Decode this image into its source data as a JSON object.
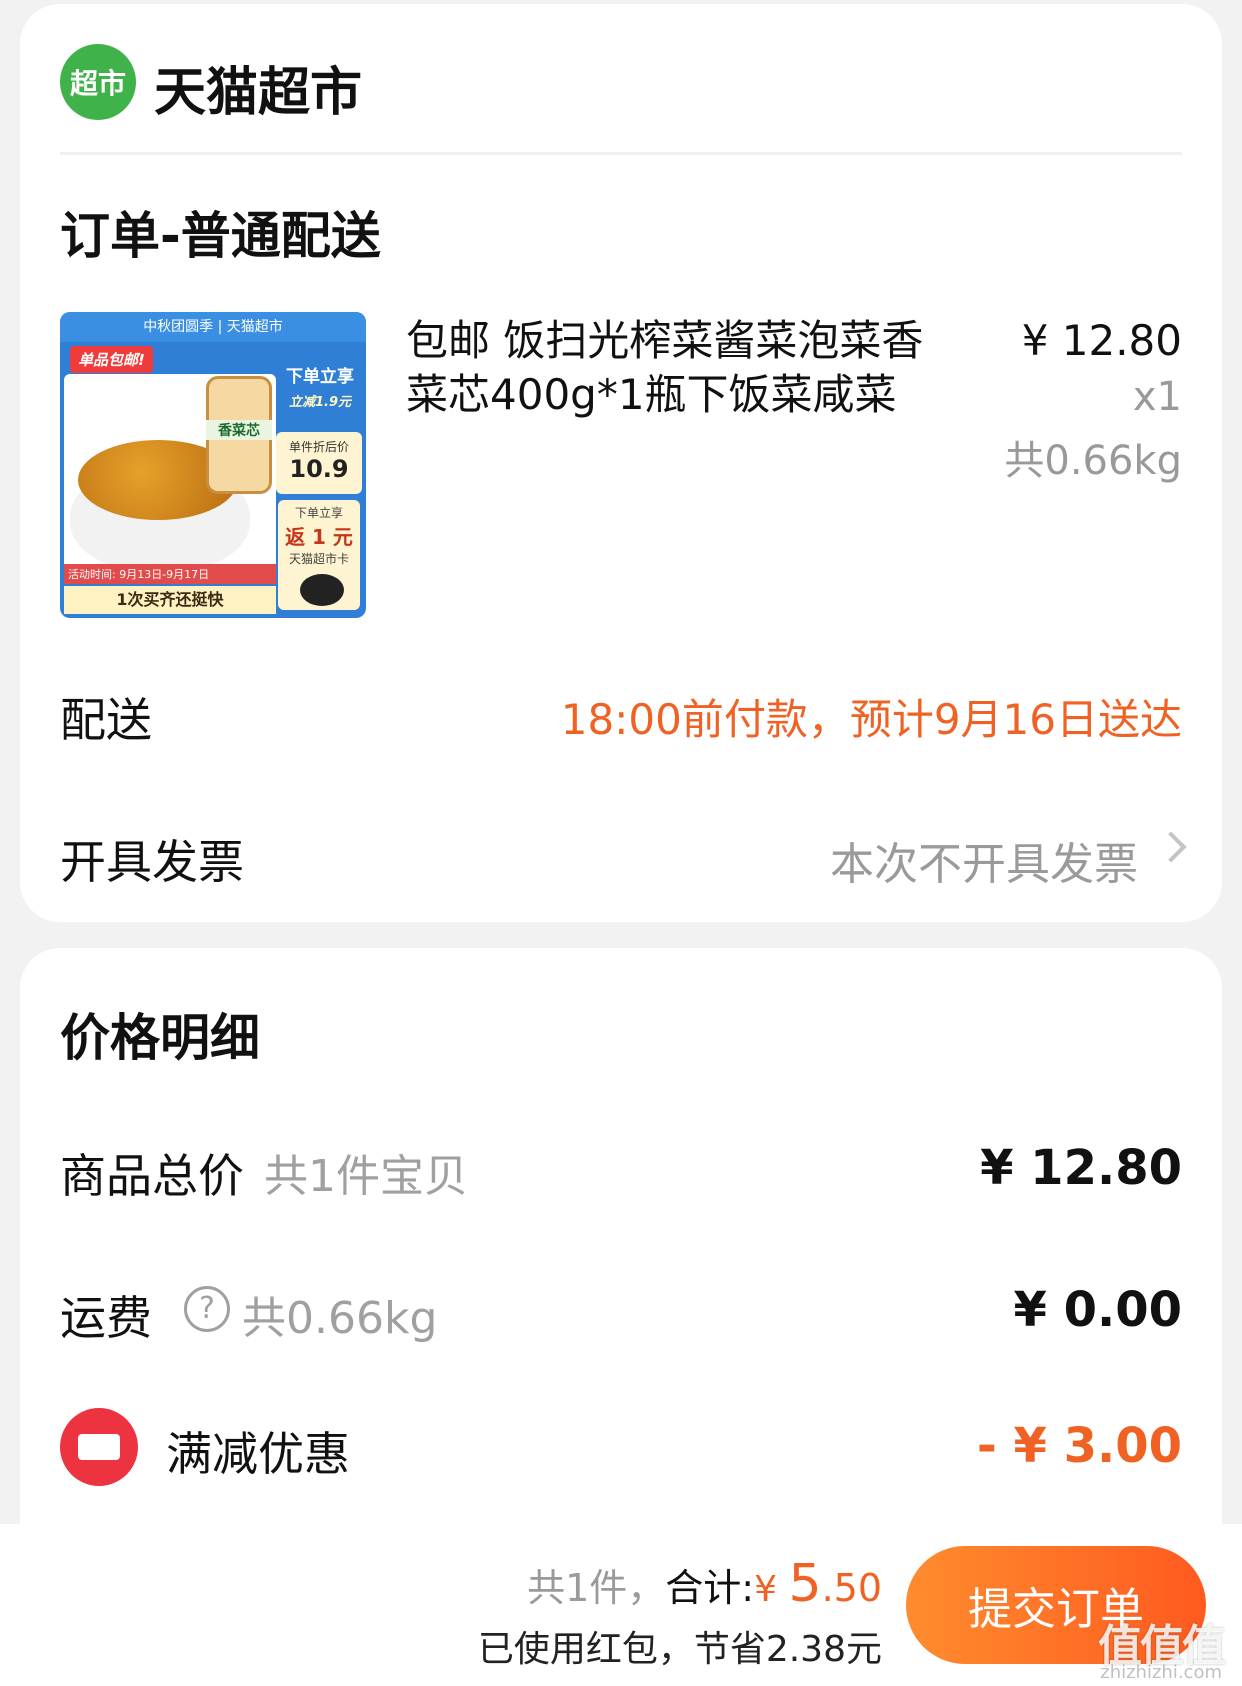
{
  "store": {
    "logo_text": "超市",
    "name": "天猫超市",
    "order_type": "订单-普通配送"
  },
  "product": {
    "image_banner": "中秋团圆季 | 天猫超市",
    "image_tag": "单品包邮!",
    "image_jar_label": "香菜芯",
    "image_side_title": "下单立享",
    "image_side_sub": "立减1.9元",
    "image_discount_label": "单件折后价",
    "image_discount_value": "10.9",
    "image_cashback_top": "下单立享",
    "image_cashback_value": "返 1 元",
    "image_cashback_bottom": "天猫超市卡",
    "image_period": "活动时间: 9月13日-9月17日",
    "image_slogan": "1次买齐还挺快",
    "title": "包邮 饭扫光榨菜酱菜泡菜香菜芯400g*1瓶下饭菜咸菜",
    "price": "¥ 12.80",
    "qty": "x1",
    "weight": "共0.66kg"
  },
  "delivery": {
    "label": "配送",
    "value": "18:00前付款，预计9月16日送达"
  },
  "invoice": {
    "label": "开具发票",
    "value": "本次不开具发票"
  },
  "price_detail": {
    "title": "价格明细",
    "goods_label": "商品总价",
    "goods_sub": "共1件宝贝",
    "goods_value": "¥ 12.80",
    "shipping_label": "运费",
    "shipping_icon": "?",
    "shipping_sub": "共0.66kg",
    "shipping_value": "¥ 0.00",
    "promo_label": "满减优惠",
    "promo_value": "- ¥ 3.00"
  },
  "bottom": {
    "count_text": "共1件，",
    "total_label": "合计:",
    "currency": "¥ ",
    "total_int": "5",
    "total_dec": ".50",
    "savings": "已使用红包，节省2.38元",
    "submit_label": "提交订单",
    "watermark": "值值值",
    "watermark_url": "zhizhizhi.com"
  },
  "colors": {
    "accent": "#f06224",
    "brand_green": "#3fb34a",
    "coupon_red": "#ee3340"
  }
}
